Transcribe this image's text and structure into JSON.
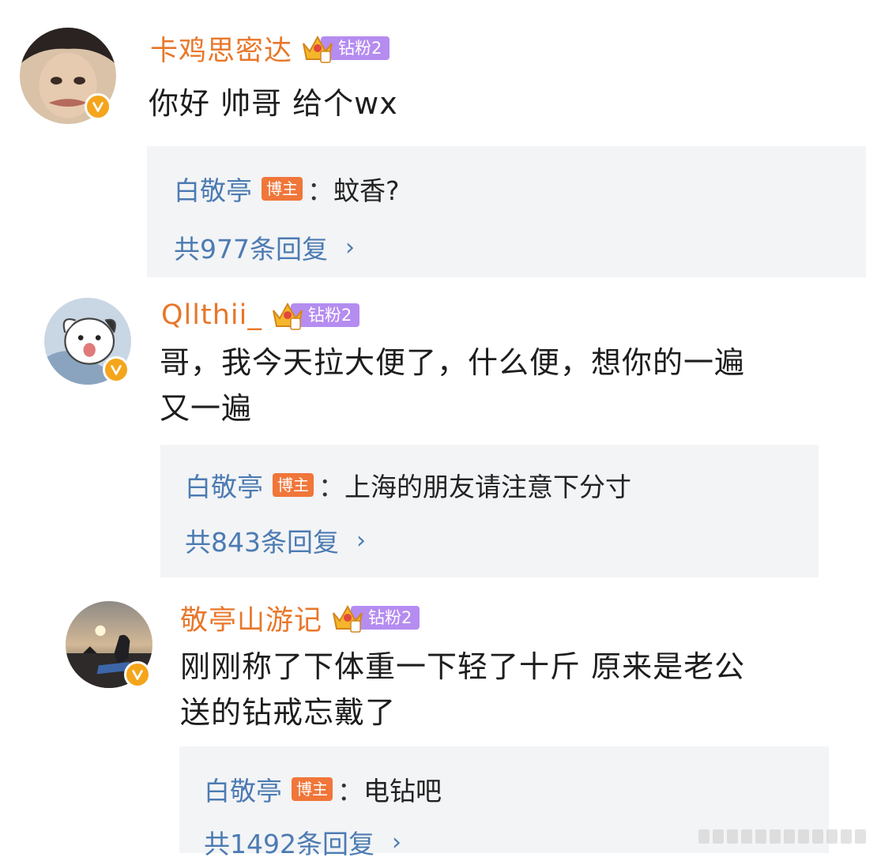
{
  "comments": [
    {
      "username": "卡鸡思密达",
      "fan_badge": "钻粉2",
      "text": "你好 帅哥 给个wx",
      "reply": {
        "author": "白敬亭",
        "tag": "博主",
        "colon": "：",
        "text": "蚊香?",
        "count_label": "共977条回复",
        "chevron": "›"
      }
    },
    {
      "username": "Qllthii_",
      "fan_badge": "钻粉2",
      "text_line1": "哥，我今天拉大便了，什么便，想你的一遍",
      "text_line2": "又一遍",
      "reply": {
        "author": "白敬亭",
        "tag": "博主",
        "colon": "：",
        "text": "上海的朋友请注意下分寸",
        "count_label": "共843条回复",
        "chevron": "›"
      }
    },
    {
      "username": "敬亭山游记",
      "fan_badge": "钻粉2",
      "text_line1": "刚刚称了下体重一下轻了十斤  原来是老公",
      "text_line2": "送的钻戒忘戴了",
      "reply": {
        "author": "白敬亭",
        "tag": "博主",
        "colon": "：",
        "text": "电钻吧",
        "count_label": "共1492条回复",
        "chevron": "›"
      }
    }
  ],
  "colors": {
    "username": "#e8772a",
    "reply_author": "#4c7bb2",
    "host_tag": "#f0763a",
    "fan_pill": "#b58cf0",
    "verified": "#f4a51c",
    "reply_bg": "#f3f4f6"
  },
  "icons": [
    "verified-v-icon",
    "crown-icon",
    "chevron-right-icon"
  ]
}
